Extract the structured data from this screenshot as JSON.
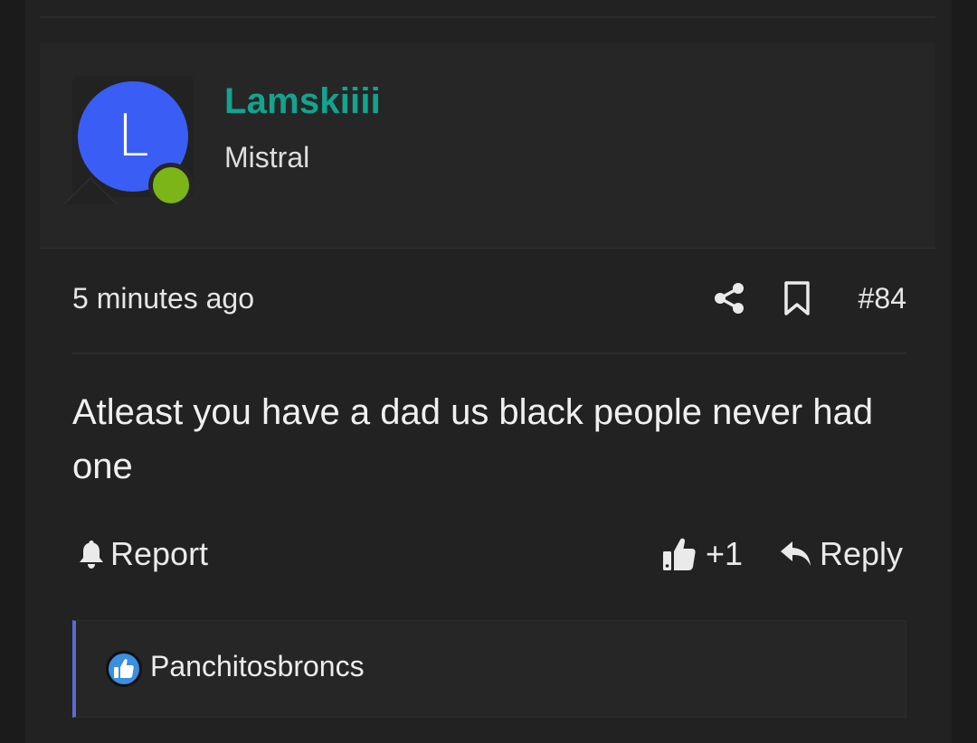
{
  "author": {
    "avatar_letter": "L",
    "username": "Lamskiiii",
    "title": "Mistral",
    "online": true
  },
  "post": {
    "timestamp": "5 minutes ago",
    "number": "#84",
    "body": "Atleast you have a dad us black people never had one"
  },
  "actions": {
    "report_label": "Report",
    "like_count": "+1",
    "reply_label": "Reply"
  },
  "reactions": {
    "user": "Panchitosbroncs"
  },
  "icons": {
    "share": "share-icon",
    "bookmark": "bookmark-icon",
    "report": "bell-icon",
    "like": "thumbs-up-icon",
    "reply": "reply-icon",
    "reaction": "like-badge-icon"
  },
  "colors": {
    "username": "#13a38e",
    "avatar_bg": "#3a5ef5",
    "online": "#7cb518",
    "reaction_accent": "#5a6ad6"
  }
}
